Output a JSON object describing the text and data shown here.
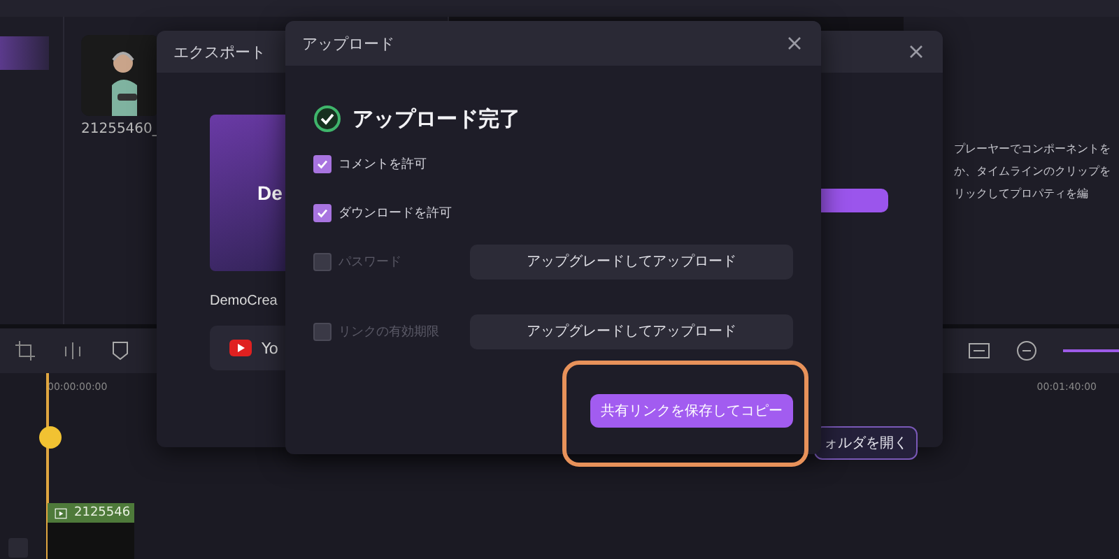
{
  "media": {
    "clip_name": "21255460_"
  },
  "right_panel": {
    "hint_lines": [
      "プレーヤーでコンポーネントを",
      "か、タイムラインのクリップを",
      "リックしてプロパティを編"
    ]
  },
  "timeline": {
    "start_time": "00:00:00:00",
    "end_time": "00:01:40:00",
    "clip_label": "2125546"
  },
  "export_dialog": {
    "title": "エクスポート",
    "thumbnail_text": "De",
    "project_name": "DemoCrea",
    "platform_button": "Yo",
    "open_folder_button": "ォルダを開く"
  },
  "upload_dialog": {
    "title": "アップロード",
    "status": "アップロード完了",
    "options": [
      {
        "label": "コメントを許可",
        "checked": true,
        "disabled": false
      },
      {
        "label": "ダウンロードを許可",
        "checked": true,
        "disabled": false
      },
      {
        "label": "パスワード",
        "checked": false,
        "disabled": true,
        "action": "アップグレードしてアップロード"
      },
      {
        "label": "リンクの有効期限",
        "checked": false,
        "disabled": true,
        "action": "アップグレードしてアップロード"
      }
    ],
    "primary_button": {
      "label": "共有リンクを保存してコピー",
      "highlighted": true
    }
  }
}
